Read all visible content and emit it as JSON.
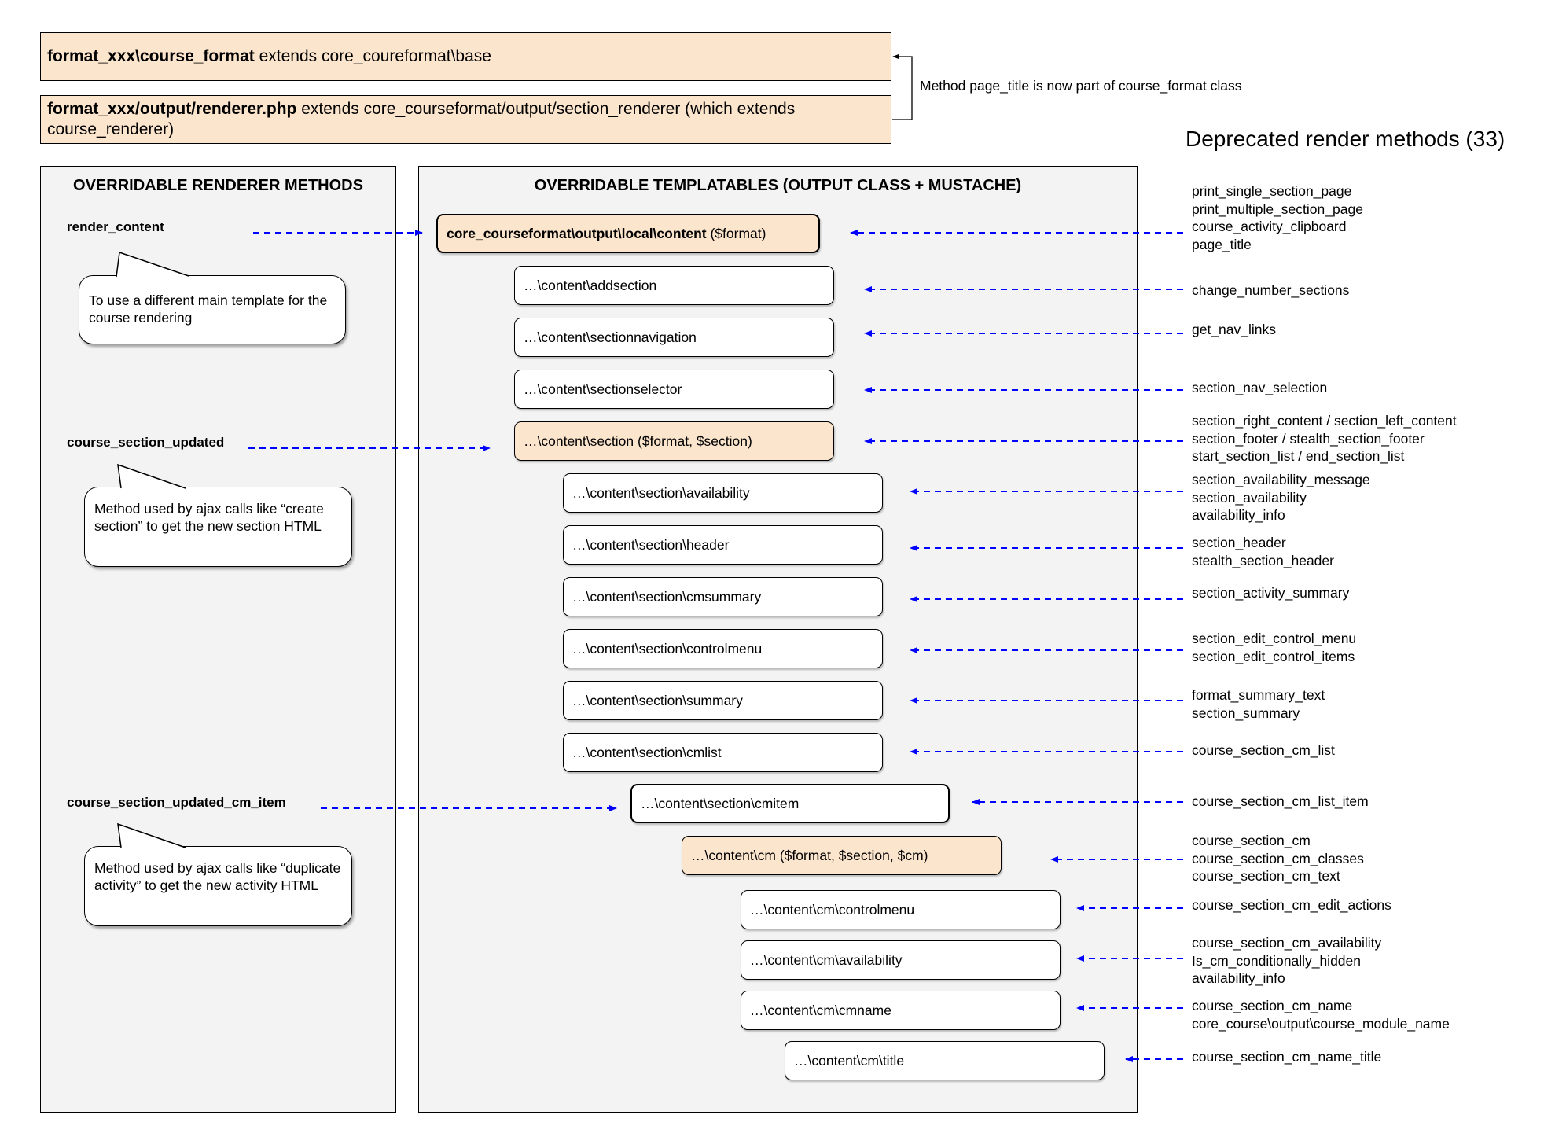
{
  "header": {
    "course_format": {
      "bold": "format_xxx\\course_format",
      "rest": " extends core_coureformat\\base"
    },
    "renderer": {
      "bold": "format_xxx/output/renderer.php",
      "rest": " extends core_courseformat/output/section_renderer (which extends course_renderer)"
    },
    "page_title_note": "Method page_title is now part of course_format class",
    "deprecated_title": "Deprecated render methods (33)"
  },
  "renderer_panel": {
    "title": "OVERRIDABLE RENDERER METHODS",
    "methods": [
      {
        "name": "render_content",
        "note": "To use a different main template for the course rendering"
      },
      {
        "name": "course_section_updated",
        "note": "Method used by ajax calls like “create section” to get the new section HTML"
      },
      {
        "name": "course_section_updated_cm_item",
        "note": "Method used by ajax calls like “duplicate activity” to get the new activity HTML"
      }
    ]
  },
  "templatables_panel": {
    "title": "OVERRIDABLE TEMPLATABLES (OUTPUT CLASS + MUSTACHE)",
    "nodes": [
      {
        "bold": "core_courseformat\\output\\local\\content",
        "rest": " ($format)"
      },
      {
        "bold": "",
        "rest": "…\\content\\addsection"
      },
      {
        "bold": "",
        "rest": "…\\content\\sectionnavigation"
      },
      {
        "bold": "",
        "rest": "…\\content\\sectionselector"
      },
      {
        "bold": "",
        "rest": "…\\content\\section ($format, $section)"
      },
      {
        "bold": "",
        "rest": "…\\content\\section\\availability"
      },
      {
        "bold": "",
        "rest": "…\\content\\section\\header"
      },
      {
        "bold": "",
        "rest": "…\\content\\section\\cmsummary"
      },
      {
        "bold": "",
        "rest": "…\\content\\section\\controlmenu"
      },
      {
        "bold": "",
        "rest": "…\\content\\section\\summary"
      },
      {
        "bold": "",
        "rest": "…\\content\\section\\cmlist"
      },
      {
        "bold": "",
        "rest": "…\\content\\section\\cmitem"
      },
      {
        "bold": "",
        "rest": "…\\content\\cm ($format, $section, $cm)"
      },
      {
        "bold": "",
        "rest": "…\\content\\cm\\controlmenu"
      },
      {
        "bold": "",
        "rest": "…\\content\\cm\\availability"
      },
      {
        "bold": "",
        "rest": "…\\content\\cm\\cmname"
      },
      {
        "bold": "",
        "rest": "…\\content\\cm\\title"
      }
    ]
  },
  "deprecated_groups": [
    [
      "print_single_section_page",
      "print_multiple_section_page",
      "course_activity_clipboard",
      "page_title"
    ],
    [
      "change_number_sections"
    ],
    [
      "get_nav_links"
    ],
    [
      "section_nav_selection"
    ],
    [
      "section_right_content / section_left_content",
      "section_footer / stealth_section_footer",
      "start_section_list / end_section_list"
    ],
    [
      "section_availability_message",
      "section_availability",
      "availability_info"
    ],
    [
      "section_header",
      "stealth_section_header"
    ],
    [
      "section_activity_summary"
    ],
    [
      "section_edit_control_menu",
      "section_edit_control_items"
    ],
    [
      "format_summary_text",
      "section_summary"
    ],
    [
      "course_section_cm_list"
    ],
    [
      "course_section_cm_list_item"
    ],
    [
      "course_section_cm",
      "course_section_cm_classes",
      "course_section_cm_text"
    ],
    [
      "course_section_cm_edit_actions"
    ],
    [
      "course_section_cm_availability",
      "Is_cm_conditionally_hidden",
      "availability_info"
    ],
    [
      "course_section_cm_name",
      "core_course\\output\\course_module_name"
    ],
    [
      "course_section_cm_name_title"
    ]
  ],
  "colors": {
    "highlight": "#fce5cd",
    "panel": "#f3f3f3",
    "arrow": "#0000ff"
  }
}
